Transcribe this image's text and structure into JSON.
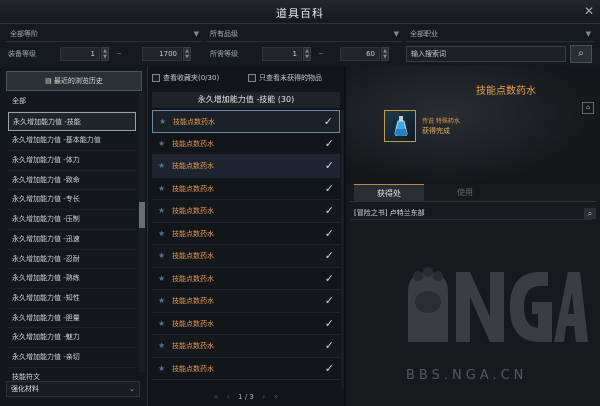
{
  "window": {
    "title": "道具百科",
    "close_label": "✕"
  },
  "filters": {
    "region": "全部等阶",
    "grade": "所有品级",
    "job": "全部职业",
    "equip_level_label": "装备等级",
    "equip_level_min": "1",
    "equip_level_max": "1700",
    "item_level_label": "所需等级",
    "item_level_min": "1",
    "item_level_max": "60",
    "search_placeholder": "输入搜索词",
    "search_icon": "🔍"
  },
  "left": {
    "history_button": "最近的浏览历史",
    "categories": [
      "全部",
      "永久增加能力值 -技能",
      "永久增加能力值 -基本能力值",
      "永久增加能力值 -体力",
      "永久增加能力值 -致命",
      "永久增加能力值 -专长",
      "永久增加能力值 -压制",
      "永久增加能力值 -迅速",
      "永久增加能力值 -忍耐",
      "永久增加能力值 -熟练",
      "永久增加能力值 -知性",
      "永久增加能力值 -胆量",
      "永久增加能力值 -魅力",
      "永久增加能力值 -亲切",
      "技能符文"
    ],
    "bottom_dropdown": "强化材料"
  },
  "middle": {
    "check_favorites": "查看收藏夹(0/30)",
    "check_unobtained": "只查看未获得的物品",
    "header": "永久增加能力值 -技能 (30)",
    "items": [
      "技能点数药水",
      "技能点数药水",
      "技能点数药水",
      "技能点数药水",
      "技能点数药水",
      "技能点数药水",
      "技能点数药水",
      "技能点数药水",
      "技能点数药水",
      "技能点数药水",
      "技能点数药水",
      "技能点数药水"
    ],
    "pager": {
      "first": "«",
      "prev": "‹",
      "current": "1 / 3",
      "next": "›",
      "last": "»"
    }
  },
  "right": {
    "item_title": "技能点数药水",
    "grade_text": "传说 特殊药水",
    "obtained_text": "获得完成",
    "tab_source": "获得处",
    "tab_use": "使用",
    "source_text": "[冒险之书] 卢特兰东部",
    "watermark_url": "BBS.NGA.CN"
  }
}
